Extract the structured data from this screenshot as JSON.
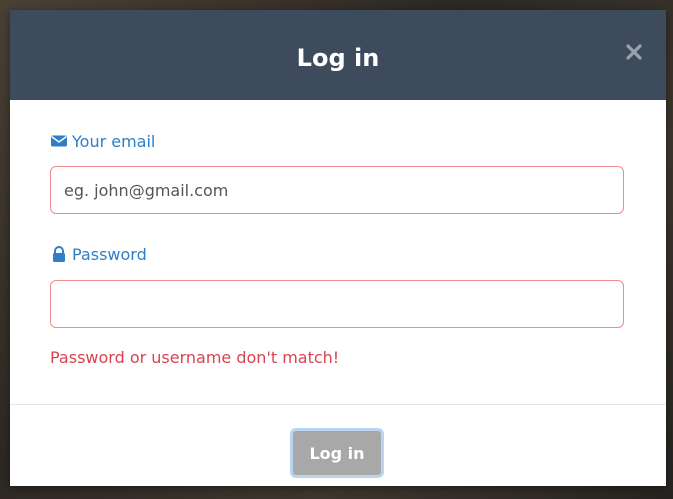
{
  "modal": {
    "title": "Log in",
    "close_icon": "close-icon",
    "header_color": "#3d4b5c"
  },
  "email": {
    "label": "Your email",
    "icon": "envelope-icon",
    "value": "",
    "placeholder": "eg. john@gmail.com"
  },
  "password": {
    "label": "Password",
    "icon": "lock-icon",
    "value": "",
    "placeholder": ""
  },
  "error": {
    "message": "Password or username don't match!",
    "color": "#d9434f"
  },
  "footer": {
    "submit_label": "Log in"
  },
  "colors": {
    "label": "#2f7ec7",
    "input_border_error": "#f08c8c",
    "button_bg": "#a8a8a8"
  }
}
